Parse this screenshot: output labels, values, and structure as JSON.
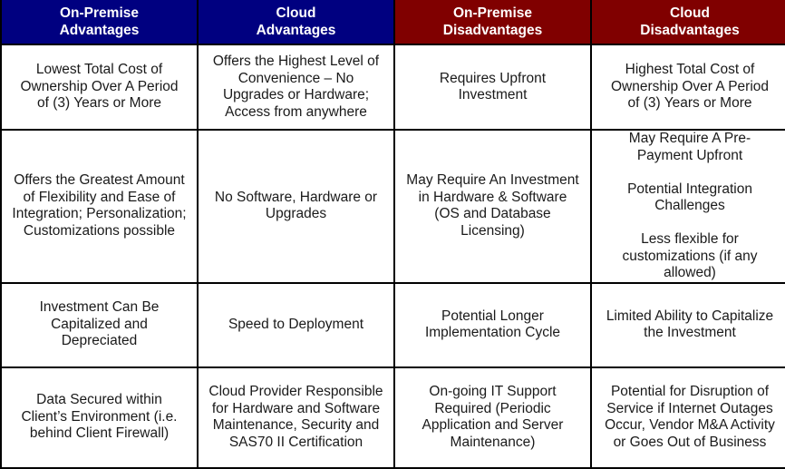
{
  "table": {
    "headers": [
      {
        "lines": [
          "On-Premise",
          "Advantages"
        ],
        "color": "#000080"
      },
      {
        "lines": [
          "Cloud",
          "Advantages"
        ],
        "color": "#000080"
      },
      {
        "lines": [
          "On-Premise",
          "Disadvantages"
        ],
        "color": "#800000"
      },
      {
        "lines": [
          "Cloud",
          "Disadvantages"
        ],
        "color": "#800000"
      }
    ],
    "rows": [
      {
        "cells": [
          [
            "Lowest Total Cost of",
            "Ownership Over A Period",
            "of (3) Years or More"
          ],
          [
            "Offers the Highest Level of",
            "Convenience – No",
            "Upgrades or Hardware;",
            "Access from anywhere"
          ],
          [
            "Requires Upfront",
            "Investment"
          ],
          [
            "Highest Total Cost of",
            "Ownership Over A Period",
            "of (3) Years or More"
          ]
        ]
      },
      {
        "cells": [
          [
            "Offers the Greatest Amount",
            "of Flexibility and Ease of",
            "Integration; Personalization;",
            "Customizations possible"
          ],
          [
            "No Software, Hardware or",
            "Upgrades"
          ],
          [
            "May Require An Investment",
            "in Hardware & Software",
            "(OS and Database",
            "Licensing)"
          ],
          [
            "May Require A Pre-",
            "Payment Upfront",
            "",
            "Potential Integration",
            "Challenges",
            "",
            "Less flexible for",
            "customizations (if any",
            "allowed)"
          ]
        ]
      },
      {
        "cells": [
          [
            "Investment Can Be",
            "Capitalized and",
            "Depreciated"
          ],
          [
            "Speed to Deployment"
          ],
          [
            "Potential Longer",
            "Implementation Cycle"
          ],
          [
            "Limited Ability to Capitalize",
            "the Investment"
          ]
        ]
      },
      {
        "cells": [
          [
            "Data Secured within",
            "Client’s Environment (i.e.",
            "behind Client Firewall)"
          ],
          [
            "Cloud Provider Responsible",
            "for Hardware and Software",
            "Maintenance, Security and",
            "SAS70 II Certification"
          ],
          [
            "On-going IT Support",
            "Required (Periodic",
            "Application and Server",
            "Maintenance)"
          ],
          [
            "Potential for Disruption of",
            "Service if Internet Outages",
            "Occur, Vendor M&A Activity",
            "or Goes Out of Business"
          ]
        ]
      }
    ]
  }
}
